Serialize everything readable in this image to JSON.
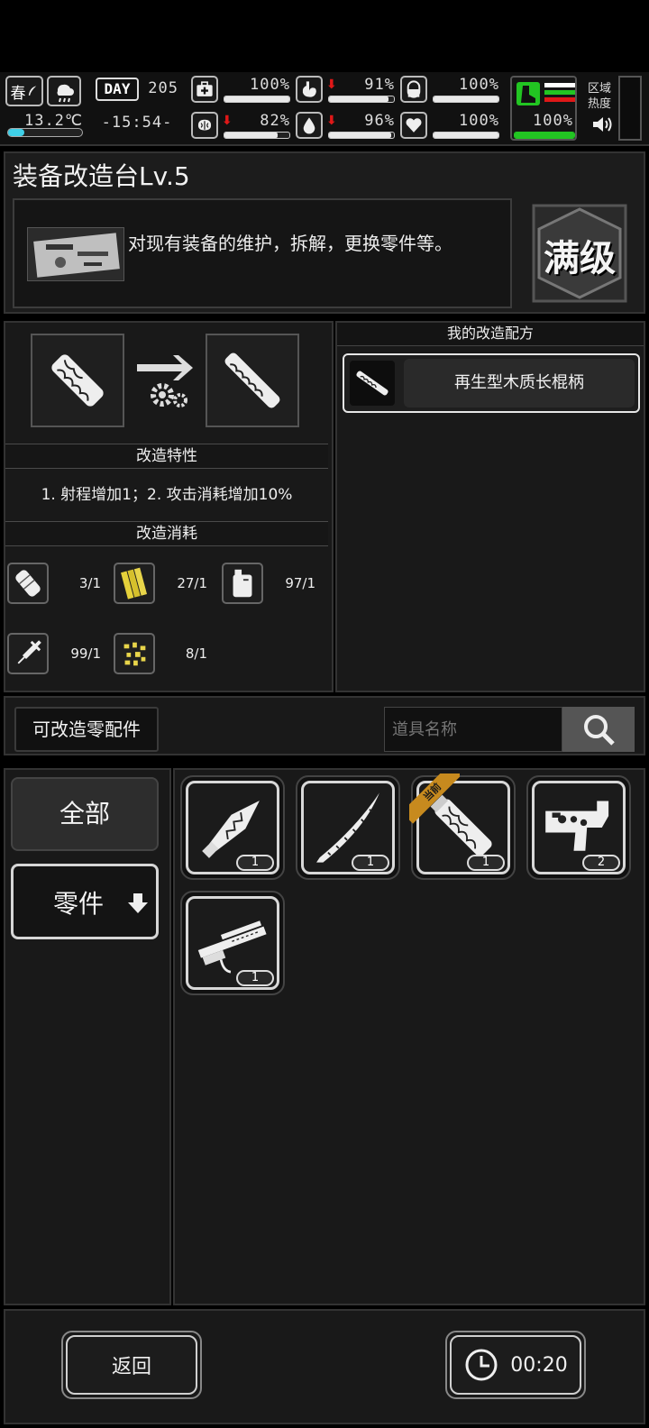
{
  "status": {
    "season": "春",
    "temperature": "13.2℃",
    "day_label": "DAY",
    "day_number": "205",
    "time": "-15:54-",
    "stats": [
      {
        "icon": "medkit-icon",
        "value": "100%",
        "fill": 1.0,
        "falling": false
      },
      {
        "icon": "stomach-icon",
        "value": "91%",
        "fill": 0.91,
        "falling": true
      },
      {
        "icon": "pill-icon",
        "value": "100%",
        "fill": 1.0,
        "falling": false
      },
      {
        "icon": "brain-icon",
        "value": "82%",
        "fill": 0.82,
        "falling": true
      },
      {
        "icon": "water-drop-icon",
        "value": "96%",
        "fill": 0.96,
        "falling": true
      },
      {
        "icon": "heart-icon",
        "value": "100%",
        "fill": 1.0,
        "falling": false
      }
    ],
    "stamina_value": "100%",
    "stamina_fill": 1.0,
    "stamina_color": "#22c522",
    "zone_heat_label_1": "区域",
    "zone_heat_label_2": "热度"
  },
  "workbench": {
    "title": "装备改造台Lv.5",
    "description": "对现有装备的维护，拆解，更换零件等。",
    "max_level_badge": "满级"
  },
  "modify": {
    "traits_header": "改造特性",
    "traits_text": "1. 射程增加1；2. 攻击消耗增加10%",
    "cost_header": "改造消耗",
    "costs": [
      {
        "icon": "bandage-icon",
        "amount": "3/1"
      },
      {
        "icon": "wood-planks-icon",
        "amount": "27/1"
      },
      {
        "icon": "fuel-can-icon",
        "amount": "97/1"
      },
      {
        "icon": "syringe-icon",
        "amount": "99/1"
      },
      {
        "icon": "scrap-pieces-icon",
        "amount": "8/1"
      }
    ]
  },
  "recipes": {
    "header": "我的改造配方",
    "items": [
      {
        "name": "再生型木质长棍柄"
      }
    ]
  },
  "parts": {
    "tab_label": "可改造零配件",
    "search_placeholder": "道具名称",
    "categories": [
      {
        "label": "全部"
      },
      {
        "label": "零件"
      }
    ],
    "current_tag": "当前",
    "items": [
      {
        "icon": "spearhead-icon",
        "qty": "1"
      },
      {
        "icon": "katana-blade-icon",
        "qty": "1"
      },
      {
        "icon": "wooden-handle-icon",
        "qty": "1",
        "current": true
      },
      {
        "icon": "gun-receiver-icon",
        "qty": "2"
      },
      {
        "icon": "rifle-barrel-icon",
        "qty": "1"
      }
    ]
  },
  "footer": {
    "back_label": "返回",
    "timer": "00:20"
  },
  "colors": {
    "accent_orange": "#c78a1e",
    "stamina_green": "#22c522",
    "alert_red": "#e01818"
  }
}
